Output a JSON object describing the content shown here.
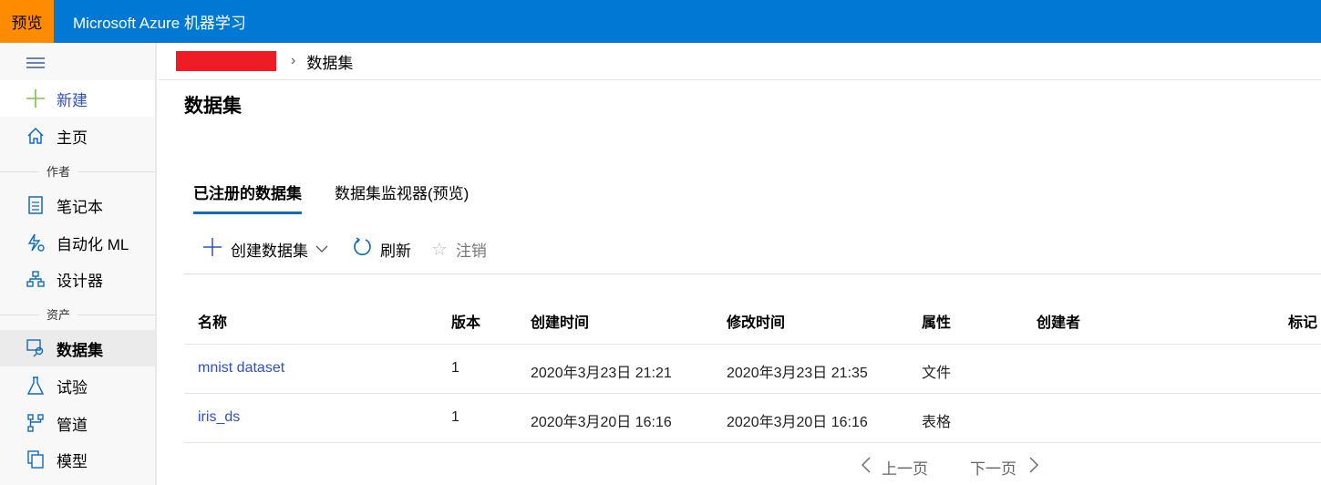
{
  "topbar": {
    "preview_badge": "预览",
    "title": "Microsoft Azure 机器学习"
  },
  "sidebar": {
    "new_label": "新建",
    "home_label": "主页",
    "section_author": "作者",
    "notebook": "笔记本",
    "automl": "自动化 ML",
    "designer": "设计器",
    "section_assets": "资产",
    "datasets": "数据集",
    "experiments": "试验",
    "pipelines": "管道",
    "models": "模型"
  },
  "breadcrumb": {
    "current": "数据集"
  },
  "page_title": "数据集",
  "tabs": [
    {
      "label": "已注册的数据集"
    },
    {
      "label": "数据集监视器(预览)"
    }
  ],
  "toolbar": {
    "create": "创建数据集",
    "refresh": "刷新",
    "unregister": "注销"
  },
  "table": {
    "columns": [
      "名称",
      "版本",
      "创建时间",
      "修改时间",
      "属性",
      "创建者",
      "标记"
    ],
    "rows": [
      {
        "name": "mnist dataset",
        "version": "1",
        "created": "2020年3月23日 21:21",
        "modified": "2020年3月23日 21:35",
        "type": "文件"
      },
      {
        "name": "iris_ds",
        "version": "1",
        "created": "2020年3月20日 16:16",
        "modified": "2020年3月20日 16:16",
        "type": "表格"
      }
    ]
  },
  "pager": {
    "prev": "上一页",
    "next": "下一页"
  }
}
